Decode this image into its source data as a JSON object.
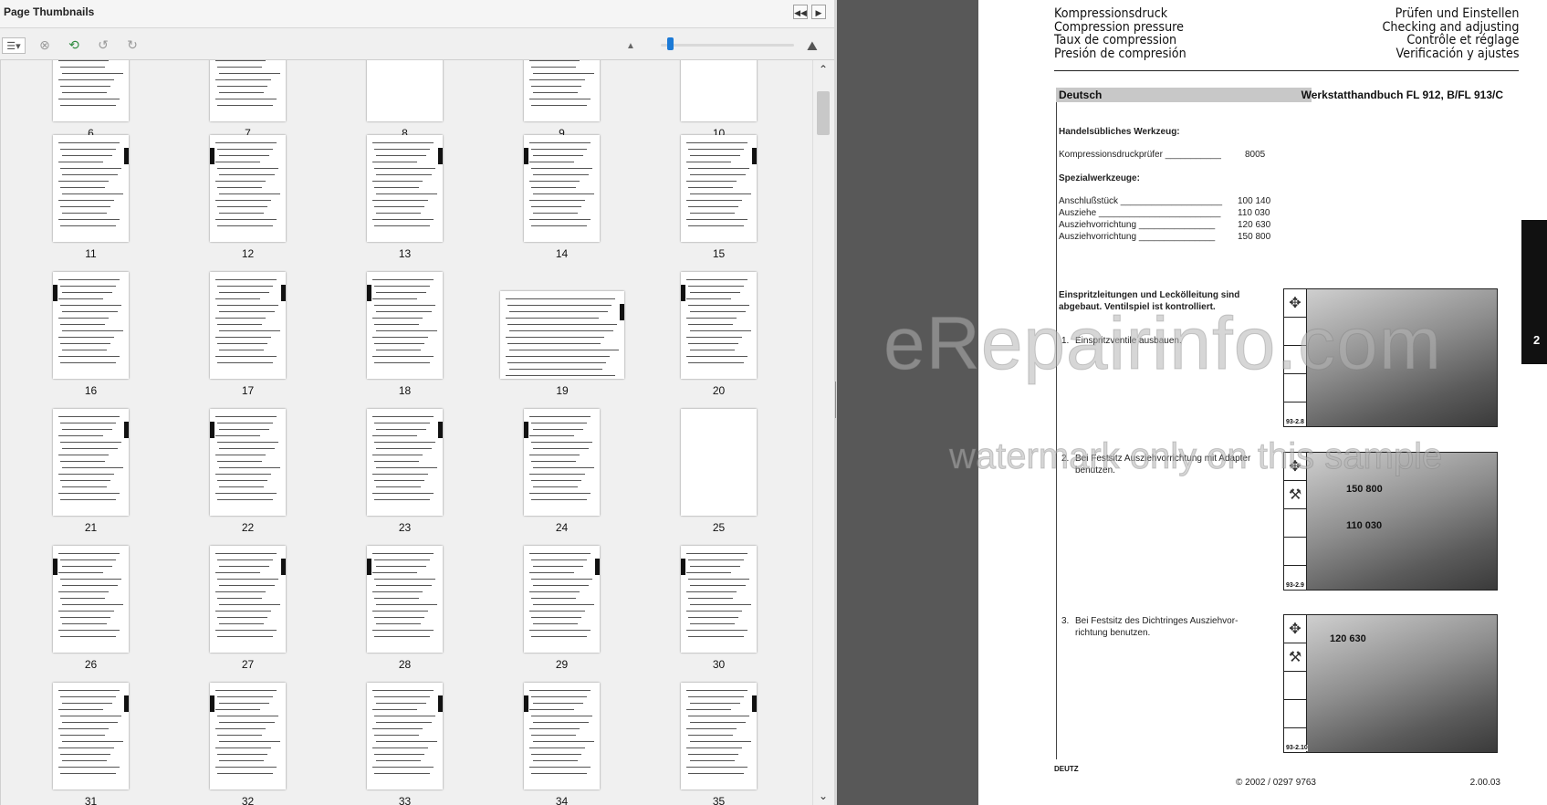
{
  "thumbnail_panel": {
    "title": "Page Thumbnails",
    "collapse_icon": "double-chevron-left-icon",
    "expand_icon": "chevron-right-icon",
    "toolbar": {
      "options_icon": "thumbnail-options-icon",
      "delete_icon": "delete-pages-icon",
      "insert_icon": "insert-pages-icon",
      "rotate_ccw_icon": "rotate-counterclockwise-icon",
      "rotate_cw_icon": "rotate-clockwise-icon",
      "zoom_out_icon": "small-mountain-icon",
      "zoom_in_icon": "large-mountain-icon",
      "zoom_level": 0.05
    },
    "page_numbers": [
      "6",
      "7",
      "8",
      "9",
      "10",
      "11",
      "12",
      "13",
      "14",
      "15",
      "16",
      "17",
      "18",
      "19",
      "20",
      "21",
      "22",
      "23",
      "24",
      "25",
      "26",
      "27",
      "28",
      "29",
      "30",
      "31",
      "32",
      "33",
      "34",
      "35"
    ]
  },
  "document": {
    "header_left": [
      "Kompressionsdruck",
      "Compression pressure",
      "Taux de compression",
      "Presión de compresión"
    ],
    "header_right": [
      "Prüfen und Einstellen",
      "Checking and adjusting",
      "Contrôle et réglage",
      "Verificación y ajustes"
    ],
    "language": "Deutsch",
    "manual_title": "Werkstatthandbuch FL 912, B/FL 913/C",
    "tools_heading": "Handelsübliches Werkzeug:",
    "tools": [
      {
        "name": "Kompressionsdruckprüfer ___________",
        "code": "8005"
      }
    ],
    "special_heading": "Spezialwerkzeuge:",
    "special_tools": [
      {
        "name": "Anschlußstück ____________________",
        "code": "100 140"
      },
      {
        "name": "Ausziehe ________________________",
        "code": "110 030"
      },
      {
        "name": "Ausziehvorrichtung _______________",
        "code": "120 630"
      },
      {
        "name": "Ausziehvorrichtung _______________",
        "code": "150 800"
      }
    ],
    "prereq_line1": "Einspritzleitungen und Leckölleitung sind",
    "prereq_line2": "abgebaut.  Ventilspiel ist kontrolliert.",
    "steps": [
      {
        "num": "1.",
        "lines": [
          "Einspritzventile ausbauen."
        ]
      },
      {
        "num": "2.",
        "lines": [
          "Bei Festsitz Ausziehvorrichtung mit Adapter",
          "benutzen."
        ]
      },
      {
        "num": "3.",
        "lines": [
          "Bei Festsitz des Dichtringes Ausziehvor-",
          "richtung benutzen."
        ]
      }
    ],
    "figures": [
      {
        "code": "93-2.8",
        "labels": []
      },
      {
        "code": "93-2.9",
        "labels": [
          "150 800",
          "110 030"
        ]
      },
      {
        "code": "93-2.10",
        "labels": [
          "120 630"
        ]
      }
    ],
    "chapter_tab": "2",
    "logo_text": "DEUTZ",
    "copyright": "© 2002 / 0297 9763",
    "page_number": "2.00.03"
  },
  "watermark": {
    "main": "eRepairinfo.com",
    "sub": "watermark only on this sample"
  }
}
